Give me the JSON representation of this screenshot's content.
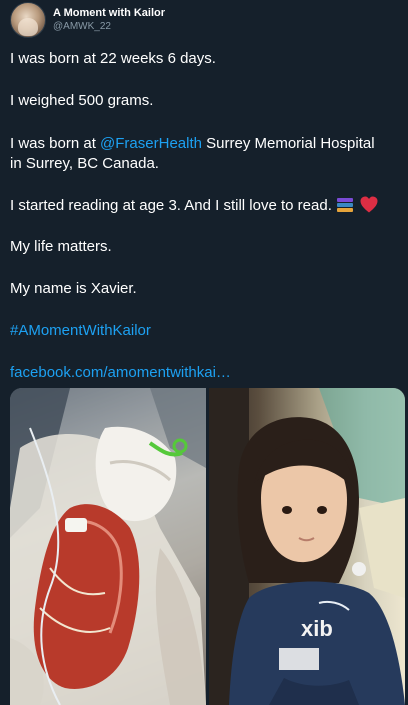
{
  "author": {
    "display_name": "A Moment with Kailor",
    "handle": "@AMWK_22",
    "avatar_icon": "profile-photo-icon"
  },
  "tweet": {
    "line1": "I was born at 22 weeks 6 days.",
    "line2": "I weighed 500 grams.",
    "line3_prefix": "I was born at ",
    "line3_mention": "@FraserHealth",
    "line3_suffix": " Surrey Memorial Hospital",
    "line4": "in Surrey, BC Canada.",
    "line5": "I started reading at age 3. And I still love to read.",
    "line5_emojis": [
      "books-emoji",
      "red-heart-emoji"
    ],
    "line6": "My life matters.",
    "line7": "My name is Xavier.",
    "hashtag": "#AMomentWithKailor",
    "link": "facebook.com/amomentwithkai…"
  },
  "media": {
    "left_photo": "premature-baby-in-incubator-photo",
    "right_photo": "young-child-portrait-photo",
    "shirt_text": "xib"
  },
  "colors": {
    "background": "#15202b",
    "text": "#ffffff",
    "secondary": "#8899a6",
    "link": "#1da1f2",
    "heart": "#e0245e"
  }
}
